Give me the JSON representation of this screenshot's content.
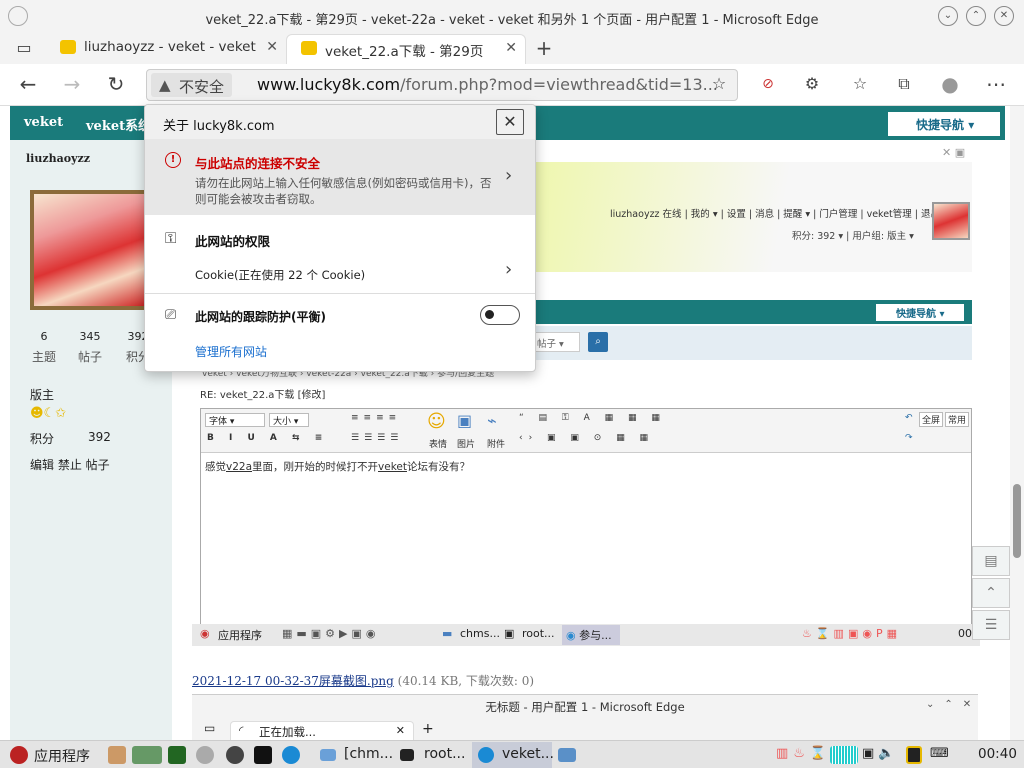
{
  "window": {
    "title": "veket_22.a下载 - 第29页 - veket-22a - veket - veket 和另外 1 个页面 - 用户配置 1 - Microsoft Edge"
  },
  "tabs": [
    {
      "label": "liuzhaoyzz - veket - veket"
    },
    {
      "label": "veket_22.a下载 - 第29页"
    }
  ],
  "address": {
    "security_label": "不安全",
    "url_host": "www.lucky8k.com",
    "url_rest": "/forum.php?mod=viewthread&tid=13..."
  },
  "forum": {
    "nav_tab_1": "veket",
    "nav_tab_2": "veket系统",
    "quick_nav": "快捷导航",
    "username": "liuzhaoyzz",
    "stats": [
      {
        "value": "6",
        "label": "主题"
      },
      {
        "value": "345",
        "label": "帖子"
      },
      {
        "value": "392",
        "label": "积分"
      }
    ],
    "rank": "版主",
    "points_label": "积分",
    "points_value": "392",
    "actions": "编辑 禁止 帖子"
  },
  "embedded": {
    "user_bar": "liuzhaoyzz 在线 | 我的 ▾ | 设置 | 消息 | 提醒 ▾ | 门户管理 | veket管理 | 退出",
    "score_bar": "积分: 392 ▾ | 用户组: 版主 ▾",
    "quick_nav": "快捷导航",
    "search_select": "帖子",
    "breadcrumb": "veket › veket万物互联 › veket-22a › veket_22.a下载 › 参与/回复主题",
    "reply_title": "RE: veket_22.a下载 [修改]",
    "font_select": "字体",
    "size_select": "大小",
    "emoji_label": "表情",
    "image_label": "图片",
    "attach_label": "附件",
    "fullscreen_label": "全屏",
    "common_label": "常用",
    "editor_text_1": "感觉",
    "editor_text_link1": "v22a",
    "editor_text_2": "里面，刚开始的时候打不开",
    "editor_text_link2": "veket",
    "editor_text_3": "论坛有没有？",
    "taskbar_apps": "应用程序",
    "taskbar_chms": "chms...",
    "taskbar_root": "root...",
    "taskbar_part": "参与...",
    "taskbar_time": "00"
  },
  "attachment": {
    "name": "2021-12-17 00-32-37屏幕截图.png",
    "meta": "(40.14 KB, 下载次数: 0)"
  },
  "nested_window": {
    "title": "无标题 - 用户配置 1 - Microsoft Edge",
    "tab": "正在加载..."
  },
  "popup": {
    "title": "关于 lucky8k.com",
    "warn_title": "与此站点的连接不安全",
    "warn_desc": "请勿在此网站上输入任何敏感信息(例如密码或信用卡)，否则可能会被攻击者窃取。",
    "permissions": "此网站的权限",
    "cookie": "Cookie(正在使用 22 个 Cookie)",
    "tracking": "此网站的跟踪防护(平衡)",
    "tracking_on": false,
    "manage": "管理所有网站"
  },
  "taskbar": {
    "apps": "应用程序",
    "item_chm": "[chm...",
    "item_root": "root...",
    "item_veket": "veket...",
    "clock": "00:40"
  },
  "colors": {
    "forum_teal": "#1a7b7b",
    "warn_red": "#cc0000",
    "link_blue": "#1a6fcf"
  }
}
